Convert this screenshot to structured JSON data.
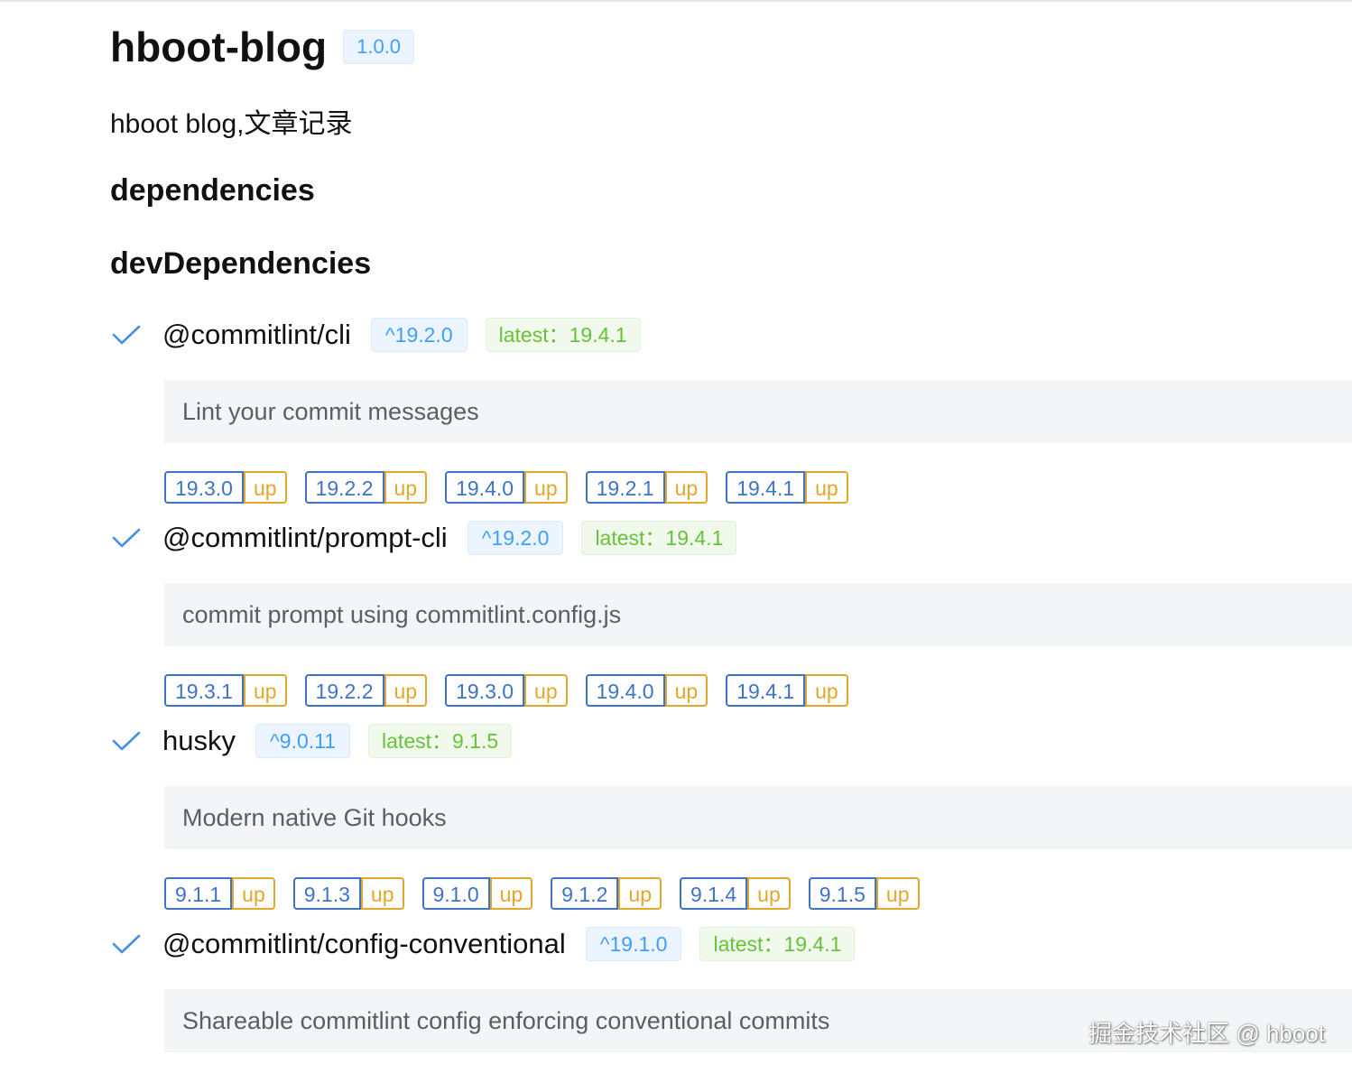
{
  "app": {
    "title": "hboot-blog",
    "version": "1.0.0",
    "description": "hboot blog,文章记录"
  },
  "sections": {
    "dependencies": "dependencies",
    "devDependencies": "devDependencies"
  },
  "packages": [
    {
      "name": "@commitlint/cli",
      "current": "^19.2.0",
      "latest": "latest：19.4.1",
      "description": "Lint your commit messages",
      "upgrades": [
        {
          "version": "19.3.0",
          "action": "up"
        },
        {
          "version": "19.2.2",
          "action": "up"
        },
        {
          "version": "19.4.0",
          "action": "up"
        },
        {
          "version": "19.2.1",
          "action": "up"
        },
        {
          "version": "19.4.1",
          "action": "up"
        }
      ]
    },
    {
      "name": "@commitlint/prompt-cli",
      "current": "^19.2.0",
      "latest": "latest：19.4.1",
      "description": "commit prompt using commitlint.config.js",
      "upgrades": [
        {
          "version": "19.3.1",
          "action": "up"
        },
        {
          "version": "19.2.2",
          "action": "up"
        },
        {
          "version": "19.3.0",
          "action": "up"
        },
        {
          "version": "19.4.0",
          "action": "up"
        },
        {
          "version": "19.4.1",
          "action": "up"
        }
      ]
    },
    {
      "name": "husky",
      "current": "^9.0.11",
      "latest": "latest：9.1.5",
      "description": "Modern native Git hooks",
      "upgrades": [
        {
          "version": "9.1.1",
          "action": "up"
        },
        {
          "version": "9.1.3",
          "action": "up"
        },
        {
          "version": "9.1.0",
          "action": "up"
        },
        {
          "version": "9.1.2",
          "action": "up"
        },
        {
          "version": "9.1.4",
          "action": "up"
        },
        {
          "version": "9.1.5",
          "action": "up"
        }
      ]
    },
    {
      "name": "@commitlint/config-conventional",
      "current": "^19.1.0",
      "latest": "latest：19.4.1",
      "description": "Shareable commitlint config enforcing conventional commits",
      "upgrades": []
    }
  ],
  "icons": {
    "installed": "check-icon"
  },
  "watermark": "掘金技术社区 @ hboot",
  "colors": {
    "version_tag": "#409eff",
    "latest_tag": "#67c23a",
    "upgrade_version_border": "#3f73c8",
    "upgrade_up": "#e3a72b",
    "check": "#4a8fe7",
    "description_bg": "#f4f5f7"
  }
}
